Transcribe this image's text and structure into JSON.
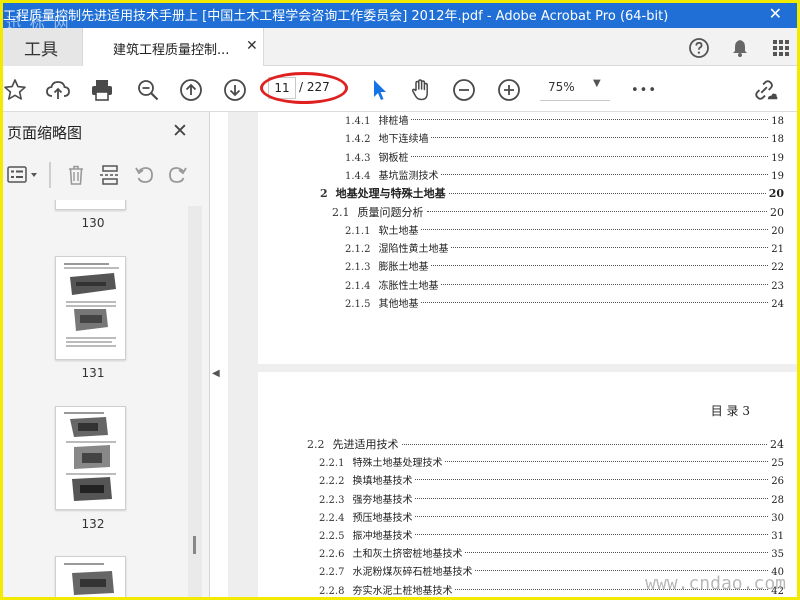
{
  "window": {
    "title": "工程质量控制先进适用技术手册上 [中国土木工程学会咨询工作委员会] 2012年.pdf - Adobe Acrobat Pro (64-bit)",
    "watermark_top": "迅 标 网",
    "close": "✕"
  },
  "tabs": {
    "tools": "工具",
    "doc": "建筑工程质量控制...",
    "doc_close": "✕"
  },
  "toolbar": {
    "current_page": "11",
    "total_pages": "/ 227",
    "zoom": "75%",
    "more": "•••"
  },
  "left_panel": {
    "title": "页面缩略图",
    "close": "✕",
    "thumbnails": [
      {
        "label": "130"
      },
      {
        "label": "131"
      },
      {
        "label": "132"
      }
    ]
  },
  "page1": {
    "rows": [
      {
        "num": "1.4.1",
        "text": "排桩墙",
        "page": "18",
        "level": "sub"
      },
      {
        "num": "1.4.2",
        "text": "地下连续墙",
        "page": "18",
        "level": "sub"
      },
      {
        "num": "1.4.3",
        "text": "钢板桩",
        "page": "19",
        "level": "sub"
      },
      {
        "num": "1.4.4",
        "text": "基坑监测技术",
        "page": "19",
        "level": "sub"
      },
      {
        "num": "2",
        "text": "地基处理与特殊土地基",
        "page": "20",
        "level": "chapter"
      },
      {
        "num": "2.1",
        "text": "质量问题分析",
        "page": "20",
        "level": "section"
      },
      {
        "num": "2.1.1",
        "text": "软土地基",
        "page": "20",
        "level": "sub"
      },
      {
        "num": "2.1.2",
        "text": "湿陷性黄土地基",
        "page": "21",
        "level": "sub"
      },
      {
        "num": "2.1.3",
        "text": "膨胀土地基",
        "page": "22",
        "level": "sub"
      },
      {
        "num": "2.1.4",
        "text": "冻胀性土地基",
        "page": "23",
        "level": "sub"
      },
      {
        "num": "2.1.5",
        "text": "其他地基",
        "page": "24",
        "level": "sub"
      }
    ]
  },
  "page2": {
    "header": "目 录   3",
    "rows": [
      {
        "num": "2.2",
        "text": "先进适用技术",
        "page": "24",
        "level": "section"
      },
      {
        "num": "2.2.1",
        "text": "特殊土地基处理技术",
        "page": "25",
        "level": "sub"
      },
      {
        "num": "2.2.2",
        "text": "换填地基技术",
        "page": "26",
        "level": "sub"
      },
      {
        "num": "2.2.3",
        "text": "强夯地基技术",
        "page": "28",
        "level": "sub"
      },
      {
        "num": "2.2.4",
        "text": "预压地基技术",
        "page": "30",
        "level": "sub"
      },
      {
        "num": "2.2.5",
        "text": "振冲地基技术",
        "page": "31",
        "level": "sub"
      },
      {
        "num": "2.2.6",
        "text": "土和灰土挤密桩地基技术",
        "page": "35",
        "level": "sub"
      },
      {
        "num": "2.2.7",
        "text": "水泥粉煤灰碎石桩地基技术",
        "page": "40",
        "level": "sub"
      },
      {
        "num": "2.2.8",
        "text": "夯实水泥土桩地基技术",
        "page": "42",
        "level": "sub"
      }
    ]
  },
  "watermark": "www.cndao.com",
  "colors": {
    "titlebar": "#1f6fd6",
    "highlight": "#e02020",
    "frame": "#f2ea00",
    "selection_tool": "#1473e6"
  },
  "icons": [
    "star-icon",
    "upload-cloud-icon",
    "print-icon",
    "zoom-out-magnifier-icon",
    "page-up-icon",
    "page-down-icon",
    "select-cursor-icon",
    "hand-icon",
    "minus-circle-icon",
    "plus-circle-icon",
    "share-link-icon",
    "help-icon",
    "bell-icon",
    "apps-grid-icon"
  ]
}
